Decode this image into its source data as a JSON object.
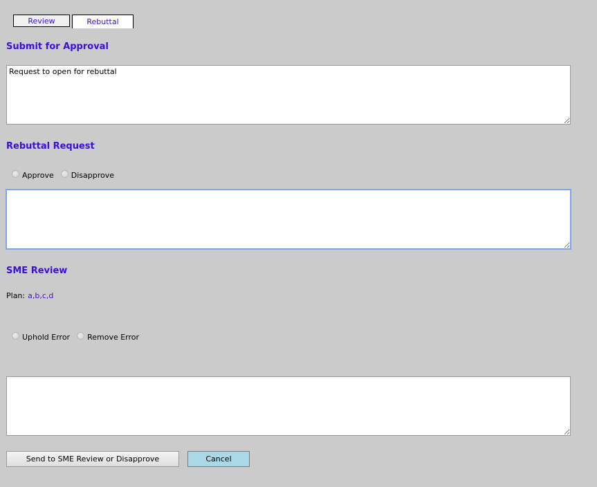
{
  "tabs": [
    {
      "label": "Review",
      "active": false
    },
    {
      "label": "Rebuttal",
      "active": true
    }
  ],
  "submit_for_approval": {
    "heading": "Submit for Approval",
    "text": "Request to open for rebuttal"
  },
  "rebuttal_request": {
    "heading": "Rebuttal Request",
    "options": [
      "Approve",
      "Disapprove"
    ],
    "comment": ""
  },
  "sme_review": {
    "heading": "SME Review",
    "plan_label": "Plan:",
    "plan_value": "a,b,c,d",
    "options": [
      "Uphold Error",
      "Remove Error"
    ],
    "comment": ""
  },
  "buttons": {
    "send": "Send to SME Review or Disapprove",
    "cancel": "Cancel"
  },
  "colors": {
    "background": "#cbcbcb",
    "heading": "#3a0fd8",
    "cancel_button": "#aad8e6",
    "focus_border": "#7ea8f5"
  }
}
